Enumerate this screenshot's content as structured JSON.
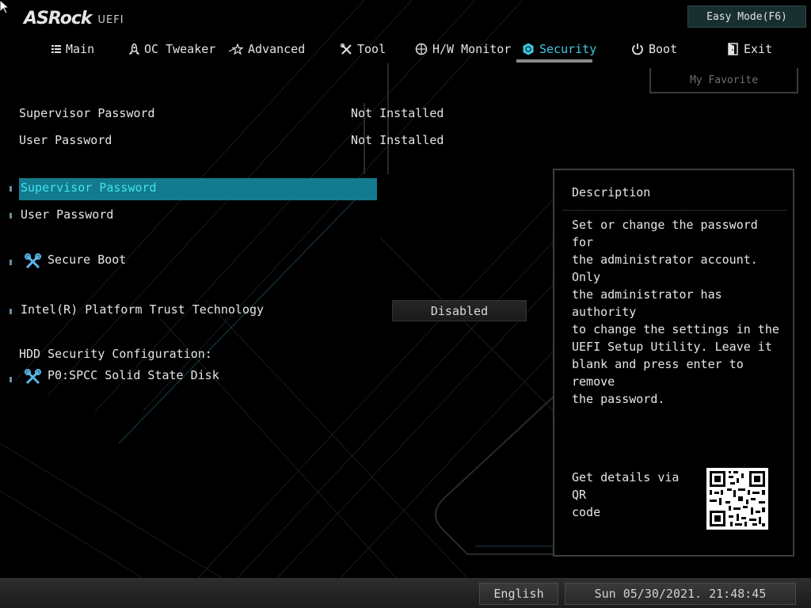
{
  "logo": {
    "brand": "ASRock",
    "suffix": "UEFI"
  },
  "easy_mode_label": "Easy Mode(F6)",
  "tabs": [
    {
      "label": "Main",
      "icon": "list-icon"
    },
    {
      "label": "OC Tweaker",
      "icon": "rocket-icon"
    },
    {
      "label": "Advanced",
      "icon": "star-icon"
    },
    {
      "label": "Tool",
      "icon": "tools-icon"
    },
    {
      "label": "H/W Monitor",
      "icon": "monitor-icon"
    },
    {
      "label": "Security",
      "icon": "shield-icon",
      "active": true
    },
    {
      "label": "Boot",
      "icon": "power-icon"
    },
    {
      "label": "Exit",
      "icon": "exit-icon"
    }
  ],
  "favorite_label": "My Favorite",
  "status": [
    {
      "label": "Supervisor Password",
      "value": "Not Installed"
    },
    {
      "label": "User Password",
      "value": "Not Installed"
    }
  ],
  "settings": {
    "supervisor_password": "Supervisor Password",
    "user_password": "User Password",
    "secure_boot": "Secure Boot",
    "ptt_label": "Intel(R) Platform Trust Technology",
    "ptt_value": "Disabled",
    "hdd_header": "HDD Security Configuration:",
    "hdd_item": "P0:SPCC Solid State Disk"
  },
  "description": {
    "title": "Description",
    "lines": [
      "Set or change the password for",
      "the administrator account. Only",
      "the administrator has authority",
      "to change the settings in the",
      "UEFI Setup Utility. Leave it",
      "blank and press enter to remove",
      "the password."
    ],
    "qr_text_lines": [
      "Get details via QR",
      "code"
    ]
  },
  "footer": {
    "language": "English",
    "datetime": "Sun 05/30/2021. 21:48:45"
  },
  "colors": {
    "accent": "#3fc8e0",
    "selected_bar": "#137b8d",
    "selected_text": "#3fe2f0"
  }
}
